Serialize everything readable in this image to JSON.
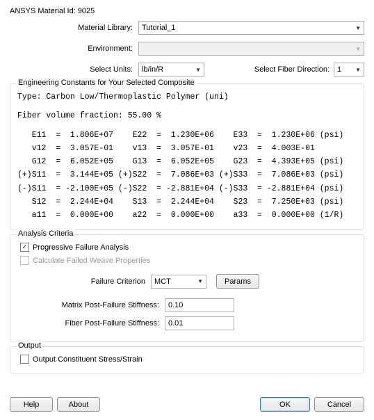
{
  "header": {
    "material_id_label": "ANSYS Material Id: 9025"
  },
  "form": {
    "material_library_label": "Material Library:",
    "material_library_value": "Tutorial_1",
    "environment_label": "Environment:",
    "environment_value": "",
    "select_units_label": "Select Units:",
    "select_units_value": "lb/in/R",
    "select_fiber_dir_label": "Select Fiber Direction:",
    "select_fiber_dir_value": "1"
  },
  "constants": {
    "legend": "Engineering Constants for Your Selected Composite",
    "type_line": "Type: Carbon Low/Thermoplastic Polymer (uni)",
    "fvf_line": "Fiber volume fraction: 55.00 %",
    "rows": [
      "   E11  =  1.806E+07    E22  =  1.230E+06    E33  =  1.230E+06 (psi)",
      "   v12  =  3.057E-01    v13  =  3.057E-01    v23  =  4.003E-01",
      "   G12  =  6.052E+05    G13  =  6.052E+05    G23  =  4.393E+05 (psi)",
      "(+)S11  =  3.144E+05 (+)S22  =  7.086E+03 (+)S33  =  7.086E+03 (psi)",
      "(-)S11  = -2.100E+05 (-)S22  = -2.881E+04 (-)S33  = -2.881E+04 (psi)",
      "   S12  =  2.244E+04    S13  =  2.244E+04    S23  =  7.250E+03 (psi)",
      "   a11  =  0.000E+00    a22  =  0.000E+00    a33  =  0.000E+00 (1/R)"
    ]
  },
  "analysis": {
    "legend": "Analysis Criteria",
    "pfa_checked": true,
    "pfa_label": "Progressive Failure Analysis",
    "cfwp_checked": false,
    "cfwp_label": "Calculate Failed Weave Properties",
    "failure_criterion_label": "Failure Criterion",
    "failure_criterion_value": "MCT",
    "params_btn": "Params",
    "matrix_pf_label": "Matrix Post-Failure Stiffness:",
    "matrix_pf_value": "0.10",
    "fiber_pf_label": "Fiber Post-Failure Stiffness:",
    "fiber_pf_value": "0.01"
  },
  "output": {
    "legend": "Output",
    "ocss_checked": false,
    "ocss_label": "Output Constituent Stress/Strain"
  },
  "buttons": {
    "help": "Help",
    "about": "About",
    "ok": "OK",
    "cancel": "Cancel"
  }
}
